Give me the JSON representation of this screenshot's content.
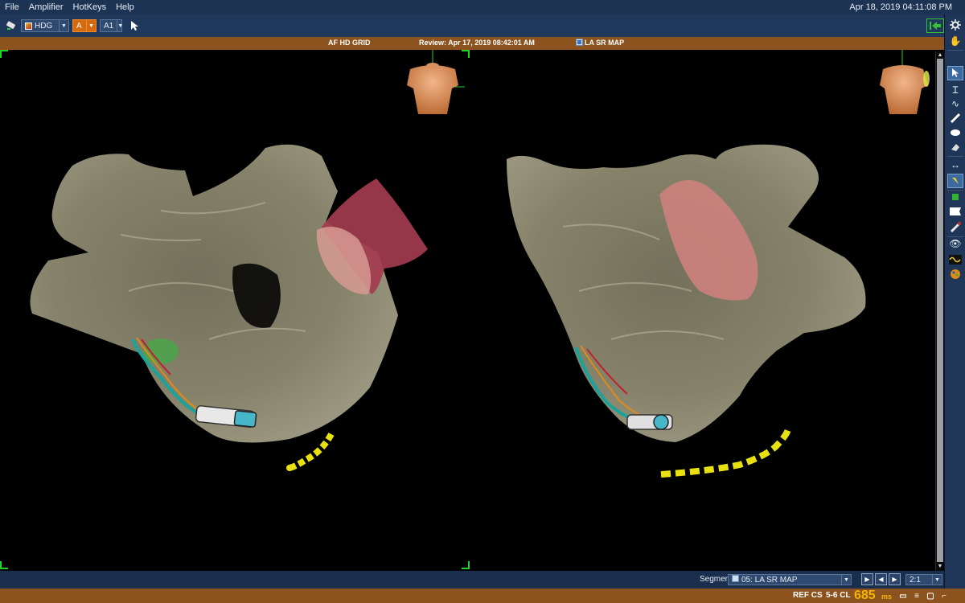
{
  "menu": {
    "items": [
      "File",
      "Amplifier",
      "HotKeys",
      "Help"
    ],
    "datetime": "Apr 18, 2019 04:11:08 PM"
  },
  "toolbar": {
    "map_combo": "HDG",
    "channel_combo": "A",
    "sub_combo": "A1"
  },
  "title_strip": {
    "left": "AF HD GRID",
    "center": "Review: Apr 17, 2019 08:42:01 AM",
    "right": "LA SR MAP"
  },
  "segment_bar": {
    "label": "Segment",
    "value": "05: LA SR MAP",
    "ratio": "2:1"
  },
  "status": {
    "ref": "REF CS",
    "cl_label": "5-6 CL",
    "cl_value": "685",
    "cl_unit": "ms"
  },
  "colors": {
    "chrome_blue": "#1d3354",
    "status_brown": "#8c531e",
    "accent_orange": "#d56a10",
    "cl_yellow": "#f6b400",
    "corner_green": "#22d422",
    "anatomy_shell": "#8f8a70",
    "appendage_red": "#a53a4e"
  },
  "icons": {
    "toolbar": [
      "tablet-icon",
      "pointer-icon",
      "back-arrow-icon"
    ],
    "right_panel": [
      "settings-icon",
      "hand-icon",
      "select-arrow-icon",
      "text-cursor-icon",
      "curve-icon",
      "line-icon",
      "ellipse-icon",
      "eraser-icon",
      "measure-icon",
      "lasso-icon",
      "layer-icon",
      "flag-icon",
      "catheter-icon",
      "eye-icon",
      "waveform-icon",
      "palette-icon"
    ],
    "status": [
      "comment-icon",
      "stack-icon",
      "monitor-icon",
      "ruler-icon"
    ]
  }
}
